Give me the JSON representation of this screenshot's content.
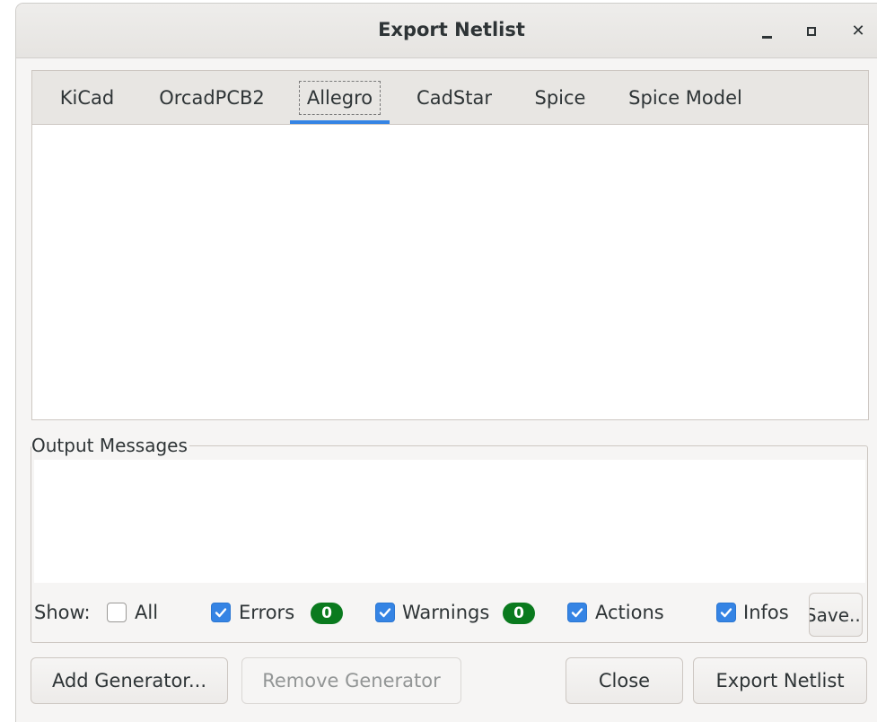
{
  "window": {
    "title": "Export Netlist",
    "controls": {
      "minimize": "minimize-icon",
      "maximize": "maximize-icon",
      "close": "close-icon"
    }
  },
  "tabs": [
    {
      "label": "KiCad",
      "active": false
    },
    {
      "label": "OrcadPCB2",
      "active": false
    },
    {
      "label": "Allegro",
      "active": true
    },
    {
      "label": "CadStar",
      "active": false
    },
    {
      "label": "Spice",
      "active": false
    },
    {
      "label": "Spice Model",
      "active": false
    }
  ],
  "output_messages": {
    "label": "Output Messages",
    "show_label": "Show:",
    "filters": {
      "all": {
        "label": "All",
        "checked": false
      },
      "errors": {
        "label": "Errors",
        "checked": true,
        "count": "0"
      },
      "warnings": {
        "label": "Warnings",
        "checked": true,
        "count": "0"
      },
      "actions": {
        "label": "Actions",
        "checked": true
      },
      "infos": {
        "label": "Infos",
        "checked": true
      }
    },
    "save_label": "Save..."
  },
  "buttons": {
    "add_generator": "Add Generator...",
    "remove_generator": "Remove Generator",
    "close": "Close",
    "export_netlist": "Export Netlist"
  },
  "colors": {
    "accent": "#3584e4",
    "badge": "#0a7a1e"
  }
}
